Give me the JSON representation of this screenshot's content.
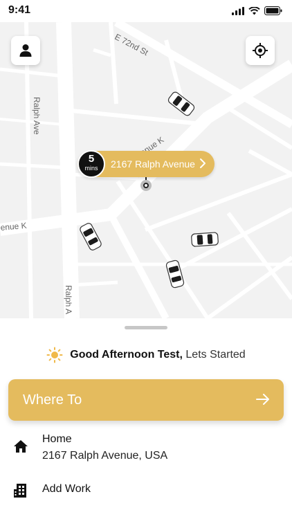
{
  "status_bar": {
    "time": "9:41"
  },
  "map": {
    "streets": {
      "e72nd": "E 72nd St",
      "ralph_ave_top": "Ralph Ave",
      "ralph_ave_bottom": "Ralph A",
      "avenue_k_mid": "enue K",
      "avenue_k_left": "enue K"
    },
    "pickup": {
      "eta_value": "5",
      "eta_unit": "mins",
      "address": "2167 Ralph Avenue"
    }
  },
  "greeting": {
    "name": "Good Afternoon Test,",
    "rest": "Lets Started"
  },
  "where_to": {
    "label": "Where To"
  },
  "places": {
    "home": {
      "title": "Home",
      "subtitle": "2167 Ralph Avenue, USA"
    },
    "work": {
      "title": "Add Work"
    }
  },
  "colors": {
    "accent": "#e4bb5e",
    "sun": "#f0b94a"
  },
  "icons": {
    "profile": "person-icon",
    "locate": "crosshair-icon",
    "home": "home-icon",
    "work": "building-icon",
    "arrow": "arrow-right-icon",
    "sun": "sun-icon"
  }
}
